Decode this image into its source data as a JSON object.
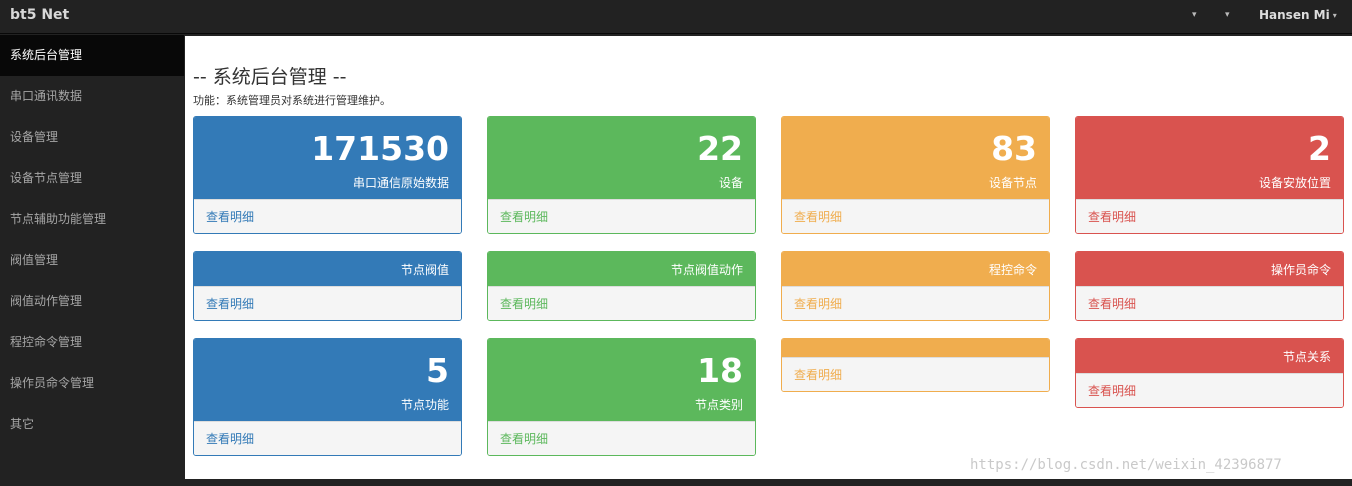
{
  "navbar": {
    "brand": "bt5 Net",
    "dropdown_caret": "▾",
    "user": "Hansen Mi"
  },
  "sidebar": {
    "items": [
      {
        "label": "系统后台管理",
        "active": true
      },
      {
        "label": "串口通讯数据"
      },
      {
        "label": "设备管理"
      },
      {
        "label": "设备节点管理"
      },
      {
        "label": "节点辅助功能管理"
      },
      {
        "label": "阀值管理"
      },
      {
        "label": "阀值动作管理"
      },
      {
        "label": "程控命令管理"
      },
      {
        "label": "操作员命令管理"
      },
      {
        "label": "其它"
      }
    ]
  },
  "main": {
    "title": "-- 系统后台管理 --",
    "description": "功能：系统管理员对系统进行管理维护。",
    "details_label": "查看明细",
    "panels": [
      {
        "color": "#337ab7",
        "value": "171530",
        "label": "串口通信原始数据"
      },
      {
        "color": "#5cb85c",
        "value": "22",
        "label": "设备"
      },
      {
        "color": "#f0ad4e",
        "value": "83",
        "label": "设备节点"
      },
      {
        "color": "#d9534f",
        "value": "2",
        "label": "设备安放位置"
      },
      {
        "color": "#337ab7",
        "label": "节点阀值"
      },
      {
        "color": "#5cb85c",
        "label": "节点阀值动作"
      },
      {
        "color": "#f0ad4e",
        "label": "程控命令"
      },
      {
        "color": "#d9534f",
        "label": "操作员命令"
      },
      {
        "color": "#337ab7",
        "value": "5",
        "label": "节点功能"
      },
      {
        "color": "#5cb85c",
        "value": "18",
        "label": "节点类别"
      },
      {
        "color": "#f0ad4e",
        "label": ""
      },
      {
        "color": "#d9534f",
        "label": "节点关系"
      }
    ]
  },
  "watermark": "https://blog.csdn.net/weixin_42396877"
}
